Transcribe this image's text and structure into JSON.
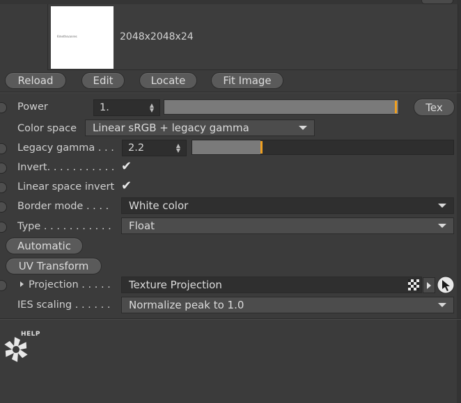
{
  "image": {
    "dimensions": "2048x2048x24",
    "thumb_caption": "Kmethsvanres"
  },
  "buttons": {
    "reload": "Reload",
    "edit": "Edit",
    "locate": "Locate",
    "fit_image": "Fit Image",
    "tex": "Tex",
    "automatic": "Automatic",
    "uv_transform": "UV Transform"
  },
  "power": {
    "label": "Power",
    "value": "1.",
    "slider_fraction": 0.985
  },
  "color_space": {
    "label": "Color space",
    "value": "Linear sRGB + legacy gamma"
  },
  "legacy_gamma": {
    "label": "Legacy gamma . . .",
    "value": "2.2",
    "slider_fraction": 0.26
  },
  "invert": {
    "label": "Invert. . . . . . . . . . .",
    "checked": true
  },
  "linear_space_invert": {
    "label": "Linear space invert",
    "checked": true
  },
  "border_mode": {
    "label": "Border mode . . . .",
    "value": "White color"
  },
  "type": {
    "label": "Type . . . . . . . . . . .",
    "value": "Float"
  },
  "projection": {
    "label": "Projection . . . . .",
    "value": "Texture Projection"
  },
  "ies_scaling": {
    "label": "IES scaling . . . . . .",
    "value": "Normalize peak to 1.0"
  },
  "help": {
    "label": "HELP"
  },
  "colors": {
    "accent": "#f0a020",
    "panel": "#3b3b3b",
    "field": "#2e2e2e"
  },
  "icons": {
    "spinner": "spinner-arrows-icon",
    "checker": "checkerboard-icon",
    "arrow": "arrow-right-icon",
    "pointer": "pick-pointer-icon",
    "help": "octane-help-icon",
    "expand": "expand-triangle-icon"
  }
}
